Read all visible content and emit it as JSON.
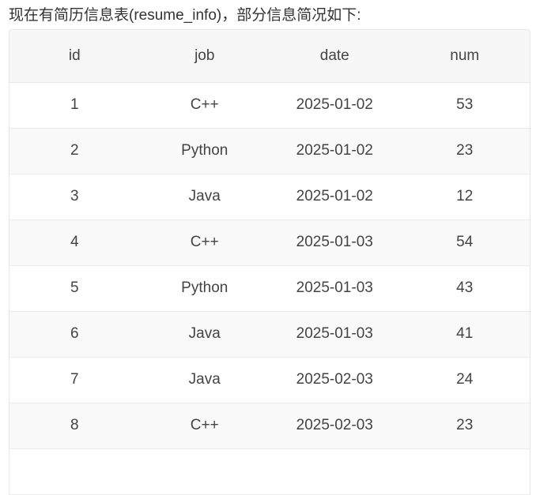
{
  "intro_text": "现在有简历信息表(resume_info)，部分信息简况如下:",
  "table": {
    "headers": [
      "id",
      "job",
      "date",
      "num"
    ],
    "rows": [
      [
        "1",
        "C++",
        "2025-01-02",
        "53"
      ],
      [
        "2",
        "Python",
        "2025-01-02",
        "23"
      ],
      [
        "3",
        "Java",
        "2025-01-02",
        "12"
      ],
      [
        "4",
        "C++",
        "2025-01-03",
        "54"
      ],
      [
        "5",
        "Python",
        "2025-01-03",
        "43"
      ],
      [
        "6",
        "Java",
        "2025-01-03",
        "41"
      ],
      [
        "7",
        "Java",
        "2025-02-03",
        "24"
      ],
      [
        "8",
        "C++",
        "2025-02-03",
        "23"
      ],
      [
        "",
        "",
        "",
        ""
      ]
    ]
  },
  "colors": {
    "header_bg": "#f7f7f7",
    "stripe_bg": "#f9f9f9",
    "border": "#e8e8e8",
    "text": "#333333"
  }
}
